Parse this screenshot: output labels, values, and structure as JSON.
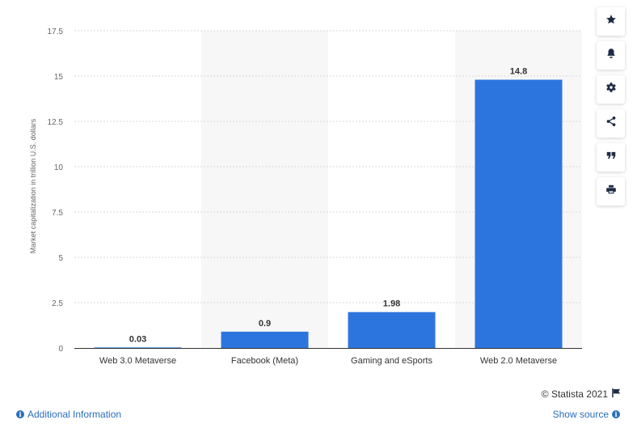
{
  "chart_data": {
    "type": "bar",
    "categories": [
      "Web 3.0 Metaverse",
      "Facebook (Meta)",
      "Gaming and eSports",
      "Web 2.0 Metaverse"
    ],
    "values": [
      0.03,
      0.9,
      1.98,
      14.8
    ],
    "value_labels": [
      "0.03",
      "0.9",
      "1.98",
      "14.8"
    ],
    "ylabel": "Market capitalization in trillion U.S. dollars",
    "yticks": [
      "0",
      "2.5",
      "5",
      "7.5",
      "10",
      "12.5",
      "15",
      "17.5"
    ],
    "ylim": [
      0,
      17.5
    ],
    "grid": true,
    "bar_color": "#2d75de",
    "band_color": "#f7f7f7"
  },
  "toolbar": {
    "icons": [
      "star-icon",
      "bell-icon",
      "gear-icon",
      "share-icon",
      "quote-icon",
      "print-icon"
    ]
  },
  "footer": {
    "copyright": "© Statista 2021",
    "additional_info": "Additional Information",
    "show_source": "Show source"
  }
}
